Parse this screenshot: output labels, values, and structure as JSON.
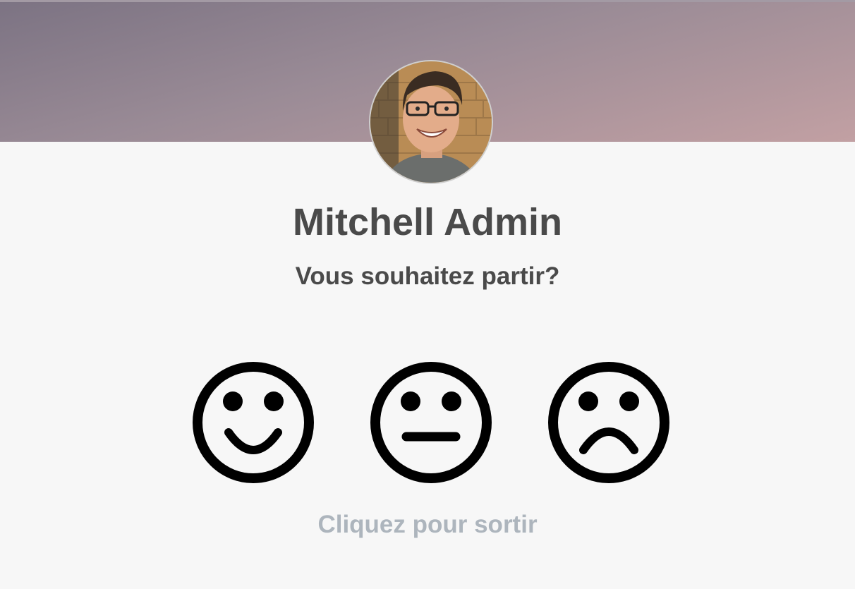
{
  "employee": {
    "name": "Mitchell Admin"
  },
  "prompt": {
    "question": "Vous souhaitez partir?",
    "exit_label": "Cliquez pour sortir"
  },
  "moods": [
    {
      "name": "happy",
      "icon": "smiley-happy-icon"
    },
    {
      "name": "neutral",
      "icon": "smiley-neutral-icon"
    },
    {
      "name": "sad",
      "icon": "smiley-sad-icon"
    }
  ],
  "colors": {
    "banner_start": "#7c7383",
    "banner_end": "#c2a0a3",
    "text": "#4a4a4a",
    "muted": "#adb5bd",
    "background": "#f7f7f7"
  }
}
